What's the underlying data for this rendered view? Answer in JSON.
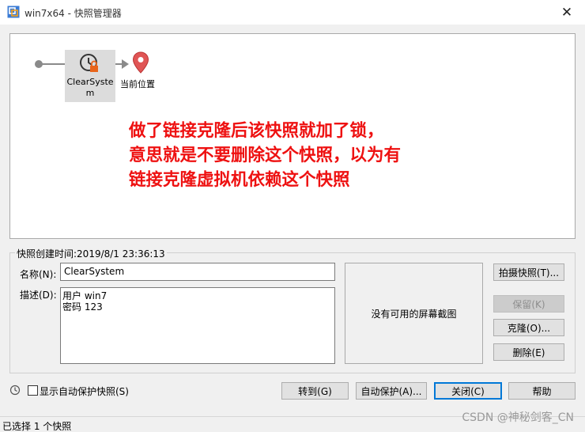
{
  "window": {
    "title": "win7x64 - 快照管理器",
    "close_glyph": "✕"
  },
  "tree": {
    "snapshot_label": "ClearSystem",
    "current_label": "当前位置"
  },
  "annotation": {
    "lines": [
      "做了链接克隆后该快照就加了锁，",
      "意思就是不要删除这个快照，以为有",
      "链接克隆虚拟机依赖这个快照"
    ]
  },
  "details": {
    "legend": "快照创建时间:2019/8/1 23:36:13",
    "name_label": "名称(N):",
    "name_value": "ClearSystem",
    "desc_label": "描述(D):",
    "desc_value": "用户 win7\n密码 123",
    "no_screenshot": "没有可用的屏幕截图"
  },
  "side_buttons": {
    "take": "拍摄快照(T)...",
    "keep": "保留(K)",
    "clone": "克隆(O)...",
    "delete": "删除(E)"
  },
  "bottom": {
    "auto_show_label": "显示自动保护快照(S)",
    "goto": "转到(G)",
    "autoprotect": "自动保护(A)...",
    "close": "关闭(C)",
    "help": "帮助"
  },
  "status": {
    "text": "已选择 1 个快照"
  },
  "watermark": "CSDN @神秘剑客_CN",
  "colors": {
    "annotation": "#ee1111",
    "lock": "#e8641b",
    "pin": "#e05555",
    "node_bg": "#dcdcdc"
  },
  "icons": [
    "vmware-icon",
    "clock-icon",
    "lock-icon",
    "location-pin-icon",
    "close-icon",
    "history-icon"
  ]
}
